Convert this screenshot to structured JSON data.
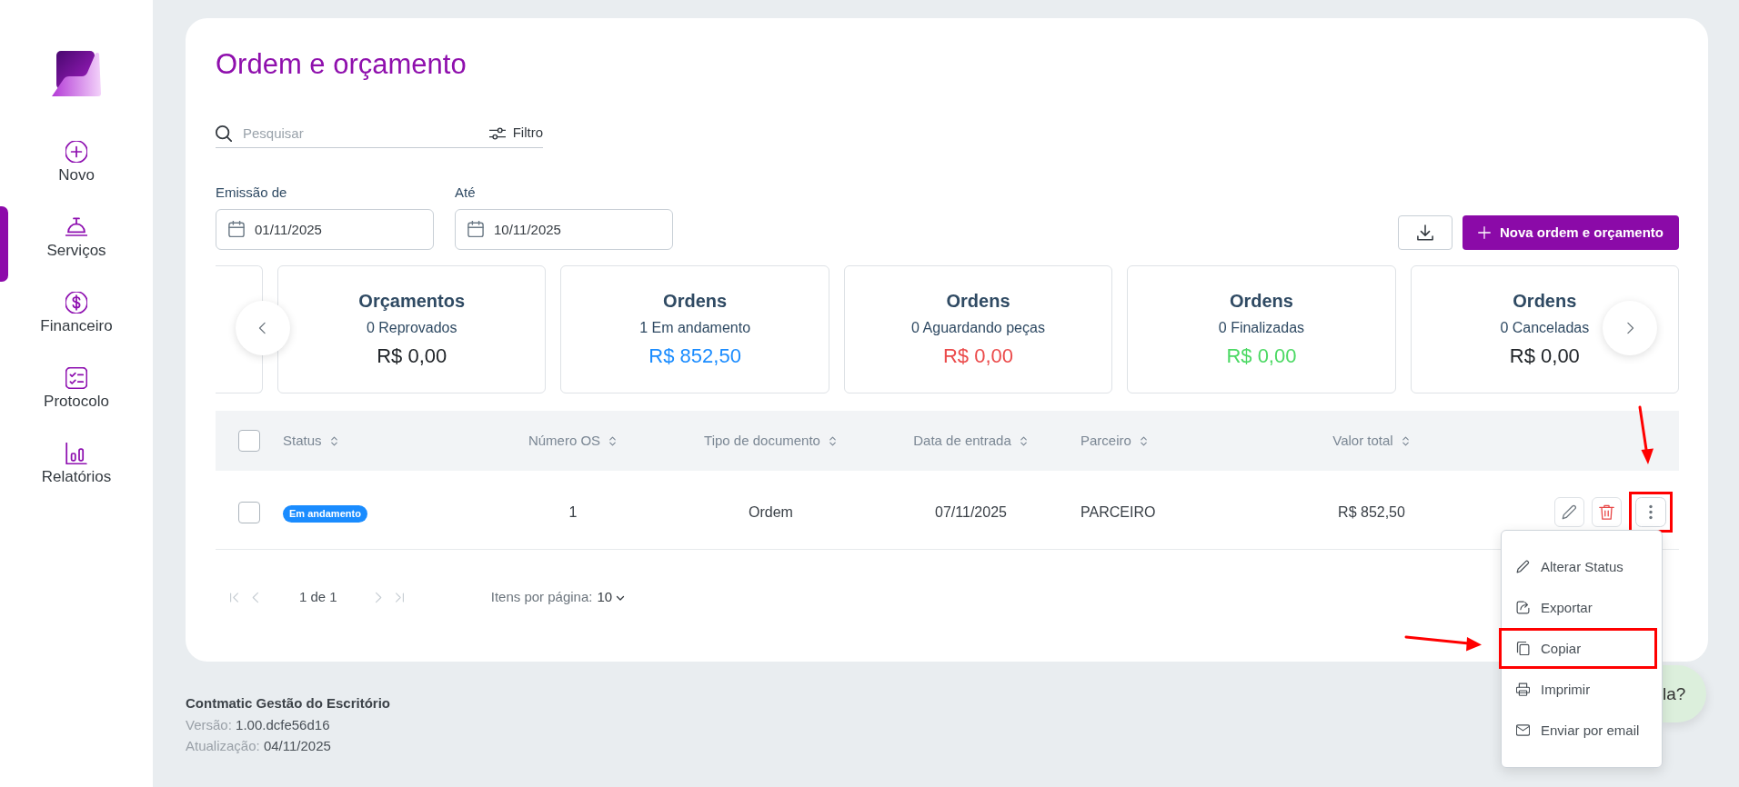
{
  "sidebar": {
    "items": [
      {
        "label": "Novo",
        "kind": "new",
        "selected": false
      },
      {
        "label": "Serviços",
        "kind": "services",
        "selected": true
      },
      {
        "label": "Financeiro",
        "kind": "finance",
        "selected": false
      },
      {
        "label": "Protocolo",
        "kind": "protocol",
        "selected": false
      },
      {
        "label": "Relatórios",
        "kind": "reports",
        "selected": false
      }
    ]
  },
  "page": {
    "title": "Ordem e orçamento"
  },
  "search": {
    "placeholder": "Pesquisar"
  },
  "filter_button": {
    "label": "Filtro"
  },
  "date_range": [
    {
      "label": "Emissão de",
      "value": "01/11/2025"
    },
    {
      "label": "Até",
      "value": "10/11/2025"
    }
  ],
  "toolbar": [
    {
      "kind": "download"
    },
    {
      "kind": "primary",
      "label": "Nova ordem e orçamento"
    }
  ],
  "summary_cards": {
    "clipped_left": true,
    "has_previous": true,
    "has_next": true,
    "cards": [
      {
        "title": "Orçamentos",
        "subtitle": "0 Reprovados",
        "value": "R$ 0,00",
        "color": "#212529"
      },
      {
        "title": "Ordens",
        "subtitle": "1 Em andamento",
        "value": "R$ 852,50",
        "color": "#1a8cff"
      },
      {
        "title": "Ordens",
        "subtitle": "0 Aguardando peças",
        "value": "R$ 0,00",
        "color": "#eb4b4b"
      },
      {
        "title": "Ordens",
        "subtitle": "0 Finalizadas",
        "value": "R$ 0,00",
        "color": "#4cd964"
      },
      {
        "title": "Ordens",
        "subtitle": "0 Canceladas",
        "value": "R$ 0,00",
        "color": "#212529"
      }
    ]
  },
  "table": {
    "select_all_checked": false,
    "columns": [
      {
        "label": "Status",
        "sortable": true
      },
      {
        "label": "Número OS",
        "sortable": true
      },
      {
        "label": "Tipo de documento",
        "sortable": true
      },
      {
        "label": "Data de entrada",
        "sortable": true
      },
      {
        "label": "Parceiro",
        "sortable": true
      },
      {
        "label": "Valor total",
        "sortable": true
      }
    ],
    "rows": [
      {
        "checked": false,
        "status": {
          "label": "Em andamento",
          "color": "#1a8cff"
        },
        "number": "1",
        "document_type": "Ordem",
        "entry_date": "07/11/2025",
        "partner": "PARCEIRO",
        "total": "R$ 852,50",
        "actions": [
          {
            "kind": "edit",
            "highlighted": false
          },
          {
            "kind": "delete",
            "highlighted": false
          },
          {
            "kind": "more",
            "highlighted": true,
            "expanded": true,
            "menu": [
              {
                "kind": "edit",
                "label": "Alterar Status",
                "highlighted": false
              },
              {
                "kind": "export",
                "label": "Exportar",
                "highlighted": false
              },
              {
                "kind": "copy",
                "label": "Copiar",
                "highlighted": true
              },
              {
                "kind": "print",
                "label": "Imprimir",
                "highlighted": false
              },
              {
                "kind": "email",
                "label": "Enviar por email",
                "highlighted": false
              }
            ]
          }
        ]
      }
    ]
  },
  "pagination": {
    "first": {
      "disabled": true
    },
    "previous": {
      "disabled": true
    },
    "page_label": "1 de 1",
    "next": {
      "disabled": true
    },
    "last": {
      "disabled": true
    },
    "page_size_label": "Itens por página:",
    "page_size": "10"
  },
  "help_widget": {
    "label": "la?"
  },
  "footer": {
    "app_name": "Contmatic Gestão do Escritório",
    "lines": [
      {
        "label": "Versão:",
        "value": "1.00.dcfe56d16"
      },
      {
        "label": "Atualização:",
        "value": "04/11/2025"
      }
    ]
  }
}
